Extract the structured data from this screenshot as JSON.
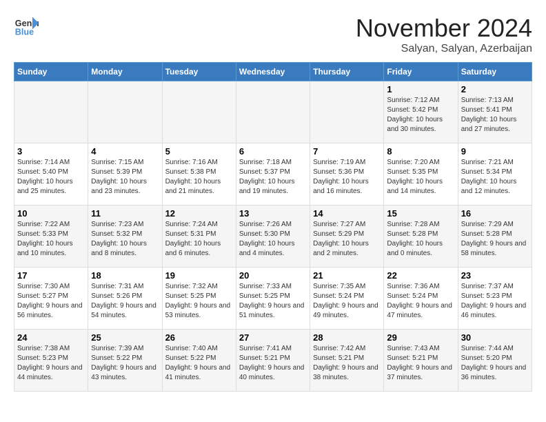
{
  "header": {
    "logo_line1": "General",
    "logo_line2": "Blue",
    "month": "November 2024",
    "location": "Salyan, Salyan, Azerbaijan"
  },
  "weekdays": [
    "Sunday",
    "Monday",
    "Tuesday",
    "Wednesday",
    "Thursday",
    "Friday",
    "Saturday"
  ],
  "weeks": [
    [
      {
        "day": "",
        "sunrise": "",
        "sunset": "",
        "daylight": ""
      },
      {
        "day": "",
        "sunrise": "",
        "sunset": "",
        "daylight": ""
      },
      {
        "day": "",
        "sunrise": "",
        "sunset": "",
        "daylight": ""
      },
      {
        "day": "",
        "sunrise": "",
        "sunset": "",
        "daylight": ""
      },
      {
        "day": "",
        "sunrise": "",
        "sunset": "",
        "daylight": ""
      },
      {
        "day": "1",
        "sunrise": "Sunrise: 7:12 AM",
        "sunset": "Sunset: 5:42 PM",
        "daylight": "Daylight: 10 hours and 30 minutes."
      },
      {
        "day": "2",
        "sunrise": "Sunrise: 7:13 AM",
        "sunset": "Sunset: 5:41 PM",
        "daylight": "Daylight: 10 hours and 27 minutes."
      }
    ],
    [
      {
        "day": "3",
        "sunrise": "Sunrise: 7:14 AM",
        "sunset": "Sunset: 5:40 PM",
        "daylight": "Daylight: 10 hours and 25 minutes."
      },
      {
        "day": "4",
        "sunrise": "Sunrise: 7:15 AM",
        "sunset": "Sunset: 5:39 PM",
        "daylight": "Daylight: 10 hours and 23 minutes."
      },
      {
        "day": "5",
        "sunrise": "Sunrise: 7:16 AM",
        "sunset": "Sunset: 5:38 PM",
        "daylight": "Daylight: 10 hours and 21 minutes."
      },
      {
        "day": "6",
        "sunrise": "Sunrise: 7:18 AM",
        "sunset": "Sunset: 5:37 PM",
        "daylight": "Daylight: 10 hours and 19 minutes."
      },
      {
        "day": "7",
        "sunrise": "Sunrise: 7:19 AM",
        "sunset": "Sunset: 5:36 PM",
        "daylight": "Daylight: 10 hours and 16 minutes."
      },
      {
        "day": "8",
        "sunrise": "Sunrise: 7:20 AM",
        "sunset": "Sunset: 5:35 PM",
        "daylight": "Daylight: 10 hours and 14 minutes."
      },
      {
        "day": "9",
        "sunrise": "Sunrise: 7:21 AM",
        "sunset": "Sunset: 5:34 PM",
        "daylight": "Daylight: 10 hours and 12 minutes."
      }
    ],
    [
      {
        "day": "10",
        "sunrise": "Sunrise: 7:22 AM",
        "sunset": "Sunset: 5:33 PM",
        "daylight": "Daylight: 10 hours and 10 minutes."
      },
      {
        "day": "11",
        "sunrise": "Sunrise: 7:23 AM",
        "sunset": "Sunset: 5:32 PM",
        "daylight": "Daylight: 10 hours and 8 minutes."
      },
      {
        "day": "12",
        "sunrise": "Sunrise: 7:24 AM",
        "sunset": "Sunset: 5:31 PM",
        "daylight": "Daylight: 10 hours and 6 minutes."
      },
      {
        "day": "13",
        "sunrise": "Sunrise: 7:26 AM",
        "sunset": "Sunset: 5:30 PM",
        "daylight": "Daylight: 10 hours and 4 minutes."
      },
      {
        "day": "14",
        "sunrise": "Sunrise: 7:27 AM",
        "sunset": "Sunset: 5:29 PM",
        "daylight": "Daylight: 10 hours and 2 minutes."
      },
      {
        "day": "15",
        "sunrise": "Sunrise: 7:28 AM",
        "sunset": "Sunset: 5:28 PM",
        "daylight": "Daylight: 10 hours and 0 minutes."
      },
      {
        "day": "16",
        "sunrise": "Sunrise: 7:29 AM",
        "sunset": "Sunset: 5:28 PM",
        "daylight": "Daylight: 9 hours and 58 minutes."
      }
    ],
    [
      {
        "day": "17",
        "sunrise": "Sunrise: 7:30 AM",
        "sunset": "Sunset: 5:27 PM",
        "daylight": "Daylight: 9 hours and 56 minutes."
      },
      {
        "day": "18",
        "sunrise": "Sunrise: 7:31 AM",
        "sunset": "Sunset: 5:26 PM",
        "daylight": "Daylight: 9 hours and 54 minutes."
      },
      {
        "day": "19",
        "sunrise": "Sunrise: 7:32 AM",
        "sunset": "Sunset: 5:25 PM",
        "daylight": "Daylight: 9 hours and 53 minutes."
      },
      {
        "day": "20",
        "sunrise": "Sunrise: 7:33 AM",
        "sunset": "Sunset: 5:25 PM",
        "daylight": "Daylight: 9 hours and 51 minutes."
      },
      {
        "day": "21",
        "sunrise": "Sunrise: 7:35 AM",
        "sunset": "Sunset: 5:24 PM",
        "daylight": "Daylight: 9 hours and 49 minutes."
      },
      {
        "day": "22",
        "sunrise": "Sunrise: 7:36 AM",
        "sunset": "Sunset: 5:24 PM",
        "daylight": "Daylight: 9 hours and 47 minutes."
      },
      {
        "day": "23",
        "sunrise": "Sunrise: 7:37 AM",
        "sunset": "Sunset: 5:23 PM",
        "daylight": "Daylight: 9 hours and 46 minutes."
      }
    ],
    [
      {
        "day": "24",
        "sunrise": "Sunrise: 7:38 AM",
        "sunset": "Sunset: 5:23 PM",
        "daylight": "Daylight: 9 hours and 44 minutes."
      },
      {
        "day": "25",
        "sunrise": "Sunrise: 7:39 AM",
        "sunset": "Sunset: 5:22 PM",
        "daylight": "Daylight: 9 hours and 43 minutes."
      },
      {
        "day": "26",
        "sunrise": "Sunrise: 7:40 AM",
        "sunset": "Sunset: 5:22 PM",
        "daylight": "Daylight: 9 hours and 41 minutes."
      },
      {
        "day": "27",
        "sunrise": "Sunrise: 7:41 AM",
        "sunset": "Sunset: 5:21 PM",
        "daylight": "Daylight: 9 hours and 40 minutes."
      },
      {
        "day": "28",
        "sunrise": "Sunrise: 7:42 AM",
        "sunset": "Sunset: 5:21 PM",
        "daylight": "Daylight: 9 hours and 38 minutes."
      },
      {
        "day": "29",
        "sunrise": "Sunrise: 7:43 AM",
        "sunset": "Sunset: 5:21 PM",
        "daylight": "Daylight: 9 hours and 37 minutes."
      },
      {
        "day": "30",
        "sunrise": "Sunrise: 7:44 AM",
        "sunset": "Sunset: 5:20 PM",
        "daylight": "Daylight: 9 hours and 36 minutes."
      }
    ]
  ]
}
